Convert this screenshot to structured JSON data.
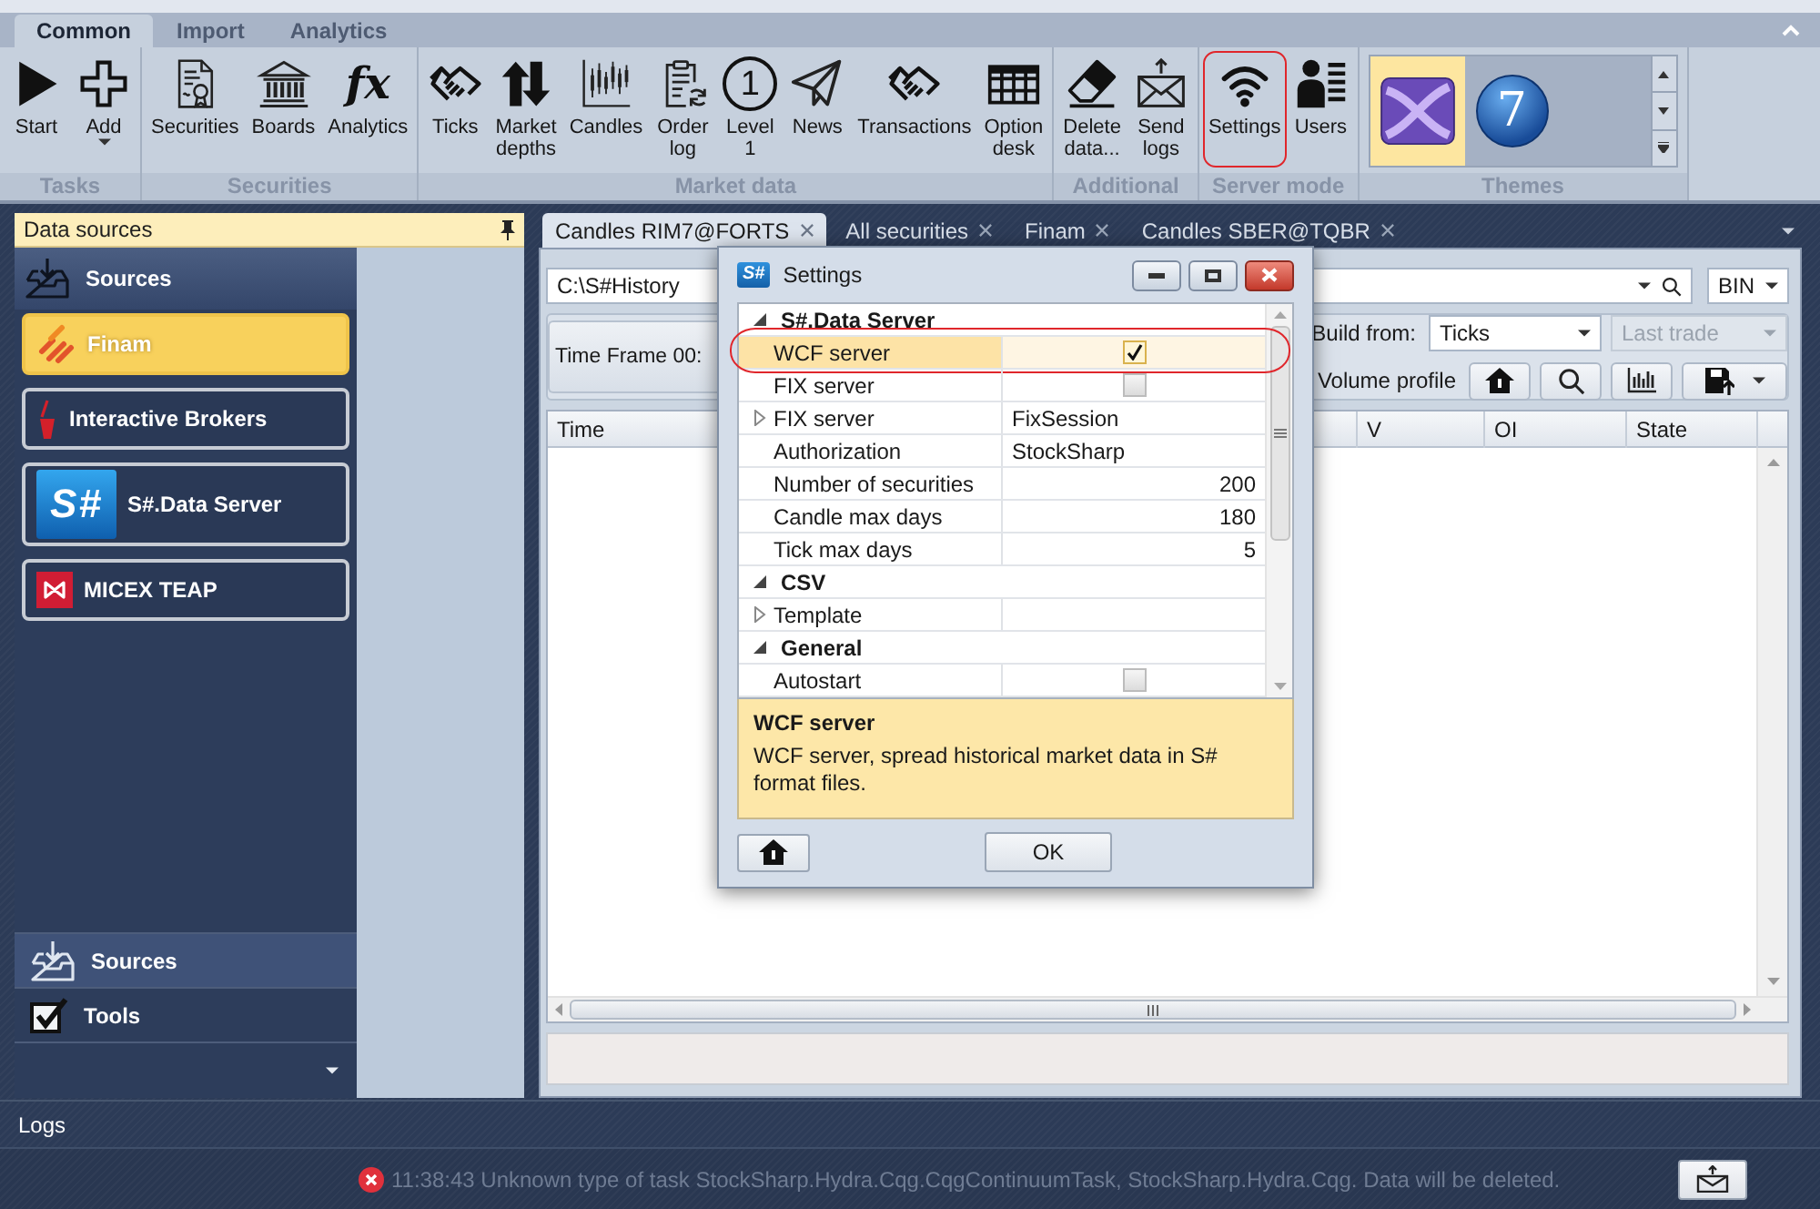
{
  "ribbon": {
    "tabs": [
      {
        "label": "Common",
        "selected": true
      },
      {
        "label": "Import",
        "selected": false
      },
      {
        "label": "Analytics",
        "selected": false
      }
    ],
    "groups": [
      {
        "label": "Tasks",
        "buttons": [
          {
            "label": "Start",
            "dropdown": false,
            "outlined": false
          },
          {
            "label": "Add",
            "dropdown": true,
            "outlined": false
          }
        ]
      },
      {
        "label": "Securities",
        "buttons": [
          {
            "label": "Securities",
            "dropdown": false,
            "outlined": false
          },
          {
            "label": "Boards",
            "dropdown": false,
            "outlined": false
          },
          {
            "label": "Analytics",
            "glyph": {
              "text": "fx",
              "kind": "italic"
            },
            "dropdown": false,
            "outlined": false
          }
        ]
      },
      {
        "label": "Market data",
        "buttons": [
          {
            "label": "Ticks",
            "dropdown": false,
            "outlined": false
          },
          {
            "label": "Market\ndepths",
            "dropdown": false,
            "outlined": false
          },
          {
            "label": "Candles",
            "dropdown": false,
            "outlined": false
          },
          {
            "label": "Order\nlog",
            "dropdown": false,
            "outlined": false
          },
          {
            "label": "Level\n1",
            "glyph": {
              "text": "1",
              "kind": "circled"
            },
            "dropdown": false,
            "outlined": false
          },
          {
            "label": "News",
            "dropdown": false,
            "outlined": false
          },
          {
            "label": "Transactions",
            "dropdown": false,
            "outlined": false
          },
          {
            "label": "Option\ndesk",
            "dropdown": false,
            "outlined": false
          }
        ]
      },
      {
        "label": "Additional",
        "buttons": [
          {
            "label": "Delete\ndata...",
            "dropdown": false,
            "outlined": false
          },
          {
            "label": "Send\nlogs",
            "dropdown": false,
            "outlined": false
          }
        ]
      },
      {
        "label": "Server mode",
        "buttons": [
          {
            "label": "Settings",
            "dropdown": false,
            "outlined": true
          },
          {
            "label": "Users",
            "dropdown": false,
            "outlined": false
          }
        ]
      }
    ],
    "themes": {
      "label": "Themes",
      "items": [
        {
          "selected": true
        },
        {
          "selected": false,
          "glyph": "7"
        }
      ]
    }
  },
  "data_sources": {
    "title": "Data sources",
    "header": "Sources",
    "items": [
      {
        "label": "Finam",
        "selected": true
      },
      {
        "label": "Interactive Brokers",
        "selected": false
      },
      {
        "label": "S#.Data Server",
        "selected": false,
        "logo_text": "S#"
      },
      {
        "label": "MICEX TEAP",
        "selected": false
      }
    ],
    "sections": [
      {
        "label": "Sources",
        "selected": true
      },
      {
        "label": "Tools",
        "selected": false
      }
    ]
  },
  "documents": {
    "tabs": [
      {
        "label": "Candles RIM7@FORTS",
        "selected": true
      },
      {
        "label": "All securities",
        "selected": false
      },
      {
        "label": "Finam",
        "selected": false
      },
      {
        "label": "Candles SBER@TQBR",
        "selected": false
      }
    ],
    "path": {
      "value": "C:\\S#History"
    },
    "format": {
      "value": "BIN"
    },
    "time_frame": "Time Frame 00:",
    "build_from": {
      "label": "Build from:",
      "source": {
        "value": "Ticks",
        "disabled": false
      },
      "field": {
        "value": "Last trade",
        "disabled": true
      }
    },
    "volume_profile": {
      "label": "Volume profile"
    },
    "table": {
      "columns": [
        "Time",
        "V",
        "OI",
        "State"
      ]
    }
  },
  "settings_dialog": {
    "title": "Settings",
    "icon_text": "S#",
    "categories": [
      {
        "label": "S#.Data Server",
        "expanded": true,
        "rows": [
          {
            "name": "WCF server",
            "kind": "checkbox",
            "checked": true,
            "expandable": false,
            "selected": true,
            "outlined": true
          },
          {
            "name": "FIX server",
            "kind": "checkbox",
            "checked": false,
            "expandable": false,
            "selected": false,
            "outlined": false
          },
          {
            "name": "FIX server",
            "kind": "text",
            "value": "FixSession",
            "expandable": true,
            "selected": false,
            "outlined": false
          },
          {
            "name": "Authorization",
            "kind": "text",
            "value": "StockSharp",
            "expandable": false,
            "selected": false,
            "outlined": false
          },
          {
            "name": "Number of securities",
            "kind": "number",
            "value": "200",
            "expandable": false,
            "selected": false,
            "outlined": false
          },
          {
            "name": "Candle max days",
            "kind": "number",
            "value": "180",
            "expandable": false,
            "selected": false,
            "outlined": false
          },
          {
            "name": "Tick max days",
            "kind": "number",
            "value": "5",
            "expandable": false,
            "selected": false,
            "outlined": false
          }
        ]
      },
      {
        "label": "CSV",
        "expanded": true,
        "rows": [
          {
            "name": "Template",
            "kind": "text",
            "expandable": true,
            "selected": false,
            "outlined": false
          }
        ]
      },
      {
        "label": "General",
        "expanded": true,
        "rows": [
          {
            "name": "Autostart",
            "kind": "checkbox",
            "checked": false,
            "expandable": false,
            "selected": false,
            "outlined": false
          }
        ]
      }
    ],
    "description": {
      "title": "WCF server",
      "text": "WCF server, spread historical market data in S# format files."
    },
    "ok_button": "OK"
  },
  "logs": {
    "title": "Logs",
    "entries": [
      {
        "kind": "error",
        "time": "11:38:43",
        "message": "Unknown type of task StockSharp.Hydra.Cqg.CqgContinuumTask, StockSharp.Hydra.Cqg. Data will be deleted."
      }
    ]
  }
}
